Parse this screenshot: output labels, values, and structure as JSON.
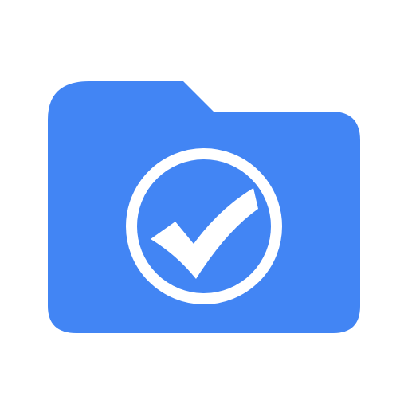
{
  "icon": {
    "name": "folder-check-icon",
    "folder_color": "#4285F4",
    "badge_color": "#FFFFFF"
  }
}
